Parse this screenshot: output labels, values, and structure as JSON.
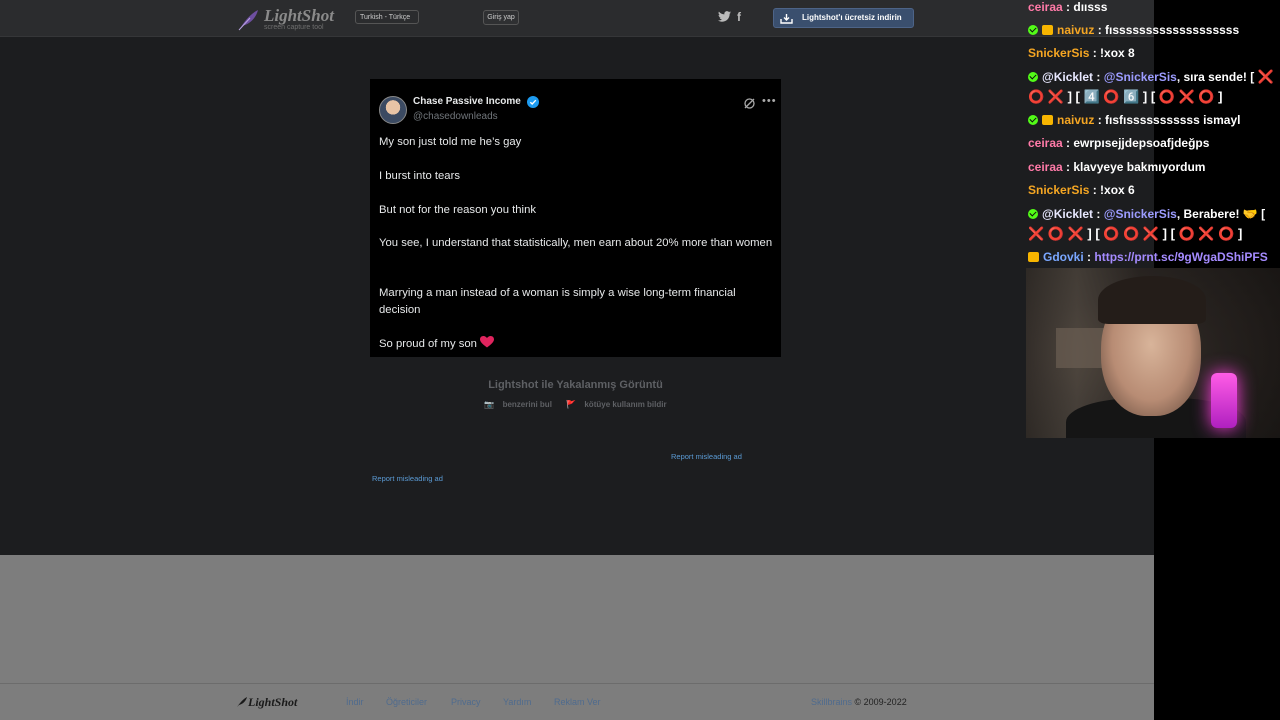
{
  "lightshot": {
    "logo_text": "LightShot",
    "logo_tagline": "screen capture tool",
    "language_selected": "Turkish - Türkçe",
    "login_label": "Giriş yap",
    "download_label": "Lightshot'ı ücretsiz indirin",
    "caption": "Lightshot ile Yakalanmış Görüntü",
    "find_similar": "benzerini bul",
    "report_abuse": "kötüye kullanım bildir",
    "report_ad_1": "Report misleading ad",
    "report_ad_2": "Report misleading ad"
  },
  "tweet": {
    "author_name": "Chase Passive Income",
    "handle": "@chasedownleads",
    "lines": [
      "My son just told me he’s gay",
      "I burst into tears",
      "But not for the reason you think",
      "You see, I understand that statistically, men earn about 20% more than women",
      "Marrying a man instead of a woman is simply a wise long-term financial decision",
      "So proud of my son"
    ]
  },
  "footer": {
    "logo_text": "LightShot",
    "links": [
      "İndir",
      "Öğreticiler",
      "Privacy",
      "Yardım",
      "Reklam Ver"
    ],
    "brand": "Skillbrains",
    "copyright": "© 2009-2022"
  },
  "chat": {
    "messages": [
      {
        "user": "ceiraa",
        "text": ": dıısss"
      },
      {
        "user": "naivuz",
        "text": ": fısssssssssssssssssss"
      },
      {
        "user": "SnickerSis",
        "text": ": !xox 8"
      },
      {
        "user": "@Kicklet",
        "text": ":",
        "mention": "@SnickerSis",
        "after": ", sıra sende! [",
        "cont": "⭕ ❌ ] [ 4️⃣ ⭕ 6️⃣ ] [ ⭕ ❌ ⭕ ]"
      },
      {
        "user": "naivuz",
        "text": ": fısfısssssssssss ismayl"
      },
      {
        "user": "ceiraa",
        "text": ": ewrpısejjdepsoafjdeğps"
      },
      {
        "user": "ceiraa",
        "text": ": klavyeye bakmıyordum"
      },
      {
        "user": "SnickerSis",
        "text": ": !xox 6"
      },
      {
        "user": "@Kicklet",
        "text": ":",
        "mention": "@SnickerSis",
        "after": ", Berabere! 🤝 [",
        "cont": "❌ ⭕ ❌ ] [ ⭕ ⭕ ❌ ] [ ⭕ ❌ ⭕ ]"
      },
      {
        "user": "Gdovki",
        "text": ":",
        "link": "https://prnt.sc/9gWgaDShiPFS"
      }
    ]
  },
  "colors": {
    "ceiraa": "#ff7aa8",
    "naivuz": "#f5a623",
    "SnickerSis": "#f5a623",
    "Kicklet": "#e8e8ff",
    "Gdovki": "#7aa7ff",
    "mention": "#9c9cff",
    "kick_green": "#53fc18",
    "link": "#5b9bd5"
  }
}
